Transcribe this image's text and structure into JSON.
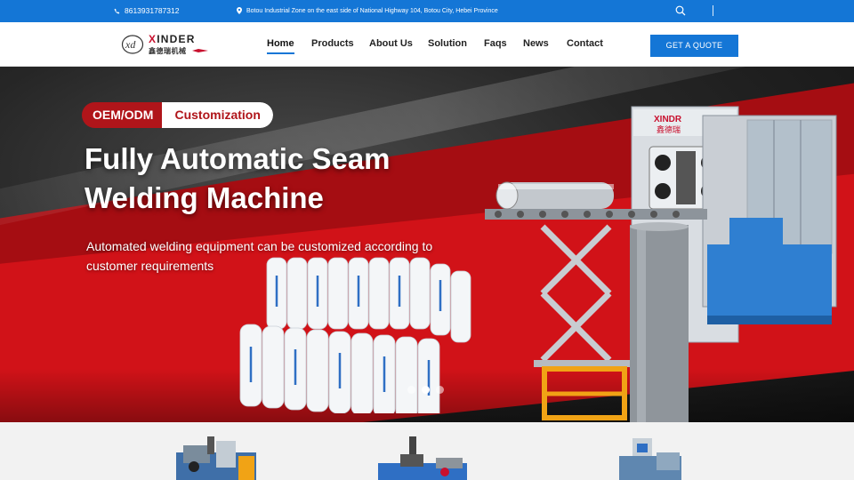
{
  "topbar": {
    "phone": "8613931787312",
    "address": "Botou Industrial Zone on the east side of National Highway 104, Botou City, Hebei Province"
  },
  "logo": {
    "brand_red": "X",
    "brand_rest": "INDER",
    "chinese": "鑫德瑞机械"
  },
  "nav": {
    "items": [
      {
        "label": "Home",
        "active": true
      },
      {
        "label": "Products",
        "active": false
      },
      {
        "label": "About Us",
        "active": false
      },
      {
        "label": "Solution",
        "active": false
      },
      {
        "label": "Faqs",
        "active": false
      },
      {
        "label": "News",
        "active": false
      },
      {
        "label": "Contact",
        "active": false
      }
    ],
    "cta": "GET A QUOTE"
  },
  "hero": {
    "badge_left": "OEM/ODM",
    "badge_right": "Customization",
    "title_line1": "Fully Automatic Seam",
    "title_line2": "Welding Machine",
    "subtitle_line1": "Automated welding equipment can be customized according to",
    "subtitle_line2": "customer requirements",
    "machine_label": "XINDR",
    "machine_label_cn": "鑫德瑞",
    "slides": 3,
    "active_slide": 2
  },
  "colors": {
    "primary": "#1476d6",
    "red": "#b0151a",
    "machine_blue": "#2f7fd1"
  },
  "icons": [
    "phone-icon",
    "location-icon",
    "search-icon"
  ]
}
